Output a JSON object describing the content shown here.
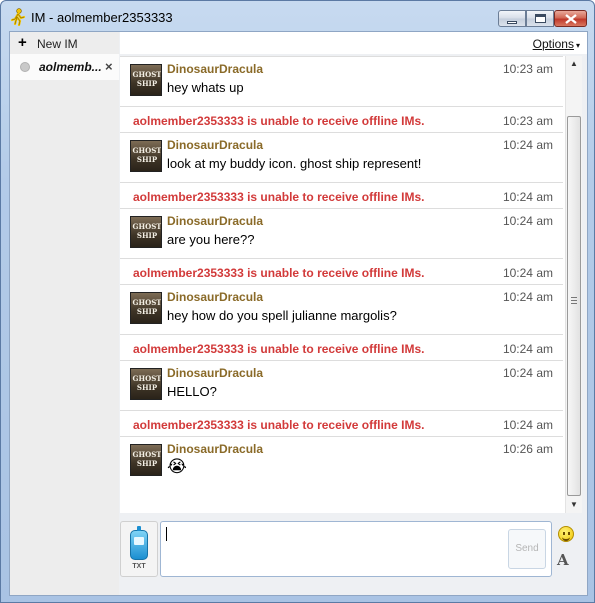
{
  "window": {
    "title": "IM - aolmember2353333",
    "title_icon": "aim-running-man-icon"
  },
  "sidebar": {
    "new_im_label": "New IM",
    "tabs": [
      {
        "label": "aolmemb...",
        "status_icon": "offline-dot-icon",
        "close": "×"
      }
    ]
  },
  "toolbar": {
    "options_label": "Options",
    "options_arrow": "▾"
  },
  "conversation": {
    "buddy_icon_text": [
      "GHOST",
      "SHIP"
    ],
    "messages": [
      {
        "kind": "im",
        "sender": "DinosaurDracula",
        "time": "10:23 am",
        "text": "hey whats up"
      },
      {
        "kind": "system",
        "text": "aolmember2353333 is unable to receive offline IMs.",
        "time": "10:23 am"
      },
      {
        "kind": "im",
        "sender": "DinosaurDracula",
        "time": "10:24 am",
        "text": "look at my buddy icon. ghost ship represent!"
      },
      {
        "kind": "system",
        "text": "aolmember2353333 is unable to receive offline IMs.",
        "time": "10:24 am"
      },
      {
        "kind": "im",
        "sender": "DinosaurDracula",
        "time": "10:24 am",
        "text": "are you here??"
      },
      {
        "kind": "system",
        "text": "aolmember2353333 is unable to receive offline IMs.",
        "time": "10:24 am"
      },
      {
        "kind": "im",
        "sender": "DinosaurDracula",
        "time": "10:24 am",
        "text": "hey how do you spell julianne margolis?"
      },
      {
        "kind": "system",
        "text": "aolmember2353333 is unable to receive offline IMs.",
        "time": "10:24 am"
      },
      {
        "kind": "im",
        "sender": "DinosaurDracula",
        "time": "10:24 am",
        "text": "HELLO?"
      },
      {
        "kind": "system",
        "text": "aolmember2353333 is unable to receive offline IMs.",
        "time": "10:24 am"
      },
      {
        "kind": "im",
        "sender": "DinosaurDracula",
        "time": "10:26 am",
        "text": "😭",
        "emoticon": "crying-face-icon"
      }
    ]
  },
  "compose": {
    "mobile_label": "TXT",
    "send_label": "Send",
    "input_value": "",
    "tools": {
      "emoticon": "smiley-icon",
      "font": "A"
    }
  },
  "colors": {
    "sender": "#8a6a28",
    "system_text": "#d23a3a",
    "frame": "#b3cbe8"
  }
}
